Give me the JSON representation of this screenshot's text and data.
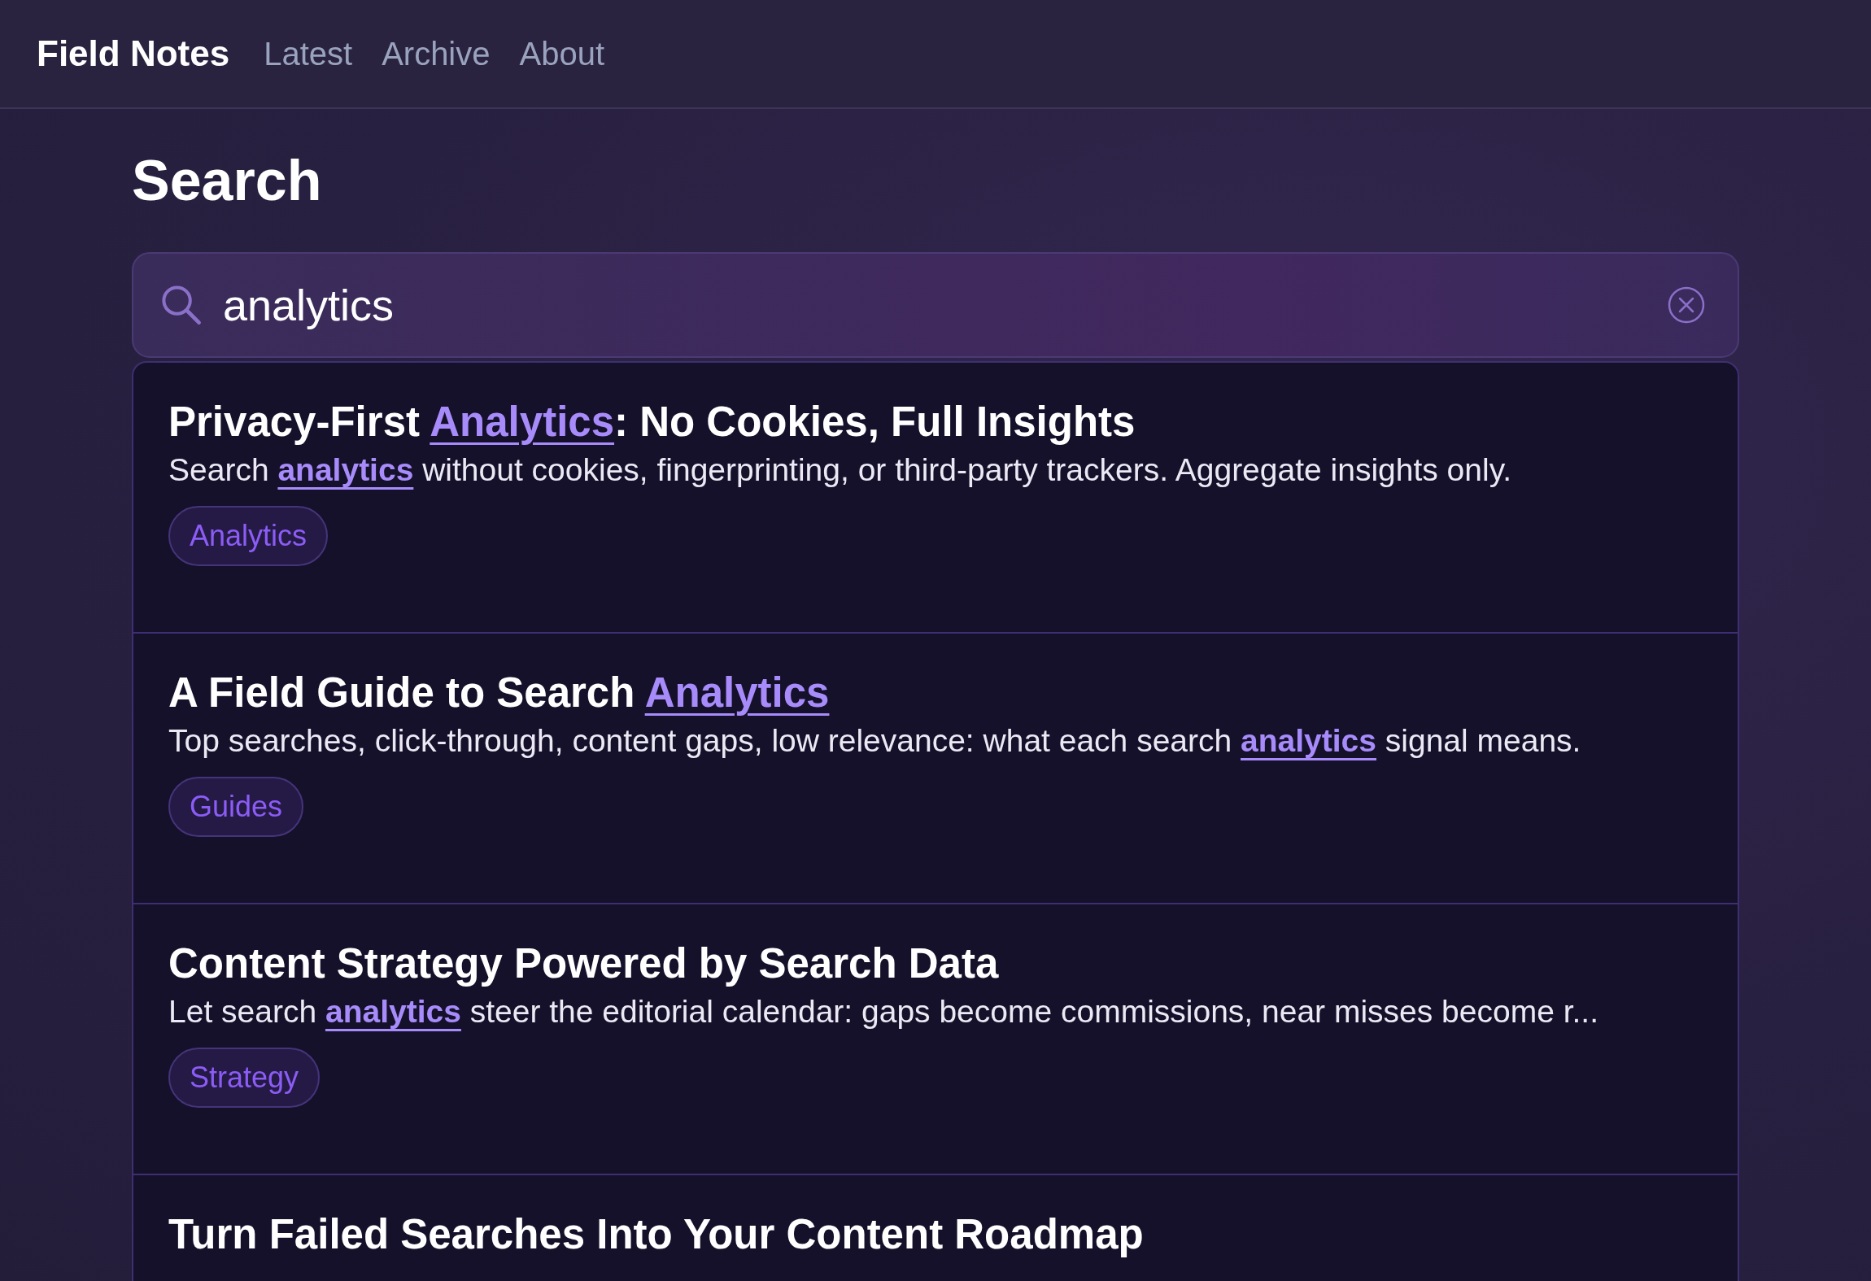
{
  "header": {
    "brand": "Field Notes",
    "nav": [
      "Latest",
      "Archive",
      "About"
    ]
  },
  "page_title": "Search",
  "search": {
    "value": "analytics"
  },
  "results": [
    {
      "title": "Privacy-First **Analytics**: No Cookies, Full Insights",
      "snippet": "Search **analytics** without cookies, fingerprinting, or third-party trackers. Aggregate insights only.",
      "tag": "Analytics"
    },
    {
      "title": "A Field Guide to Search **Analytics**",
      "snippet": "Top searches, click-through, content gaps, low relevance: what each search **analytics** signal means.",
      "tag": "Guides"
    },
    {
      "title": "Content Strategy Powered by Search Data",
      "snippet": "Let search **analytics** steer the editorial calendar: gaps become commissions, near misses become r...",
      "tag": "Strategy"
    },
    {
      "title": "Turn Failed Searches Into Your Content Roadmap"
    }
  ]
}
